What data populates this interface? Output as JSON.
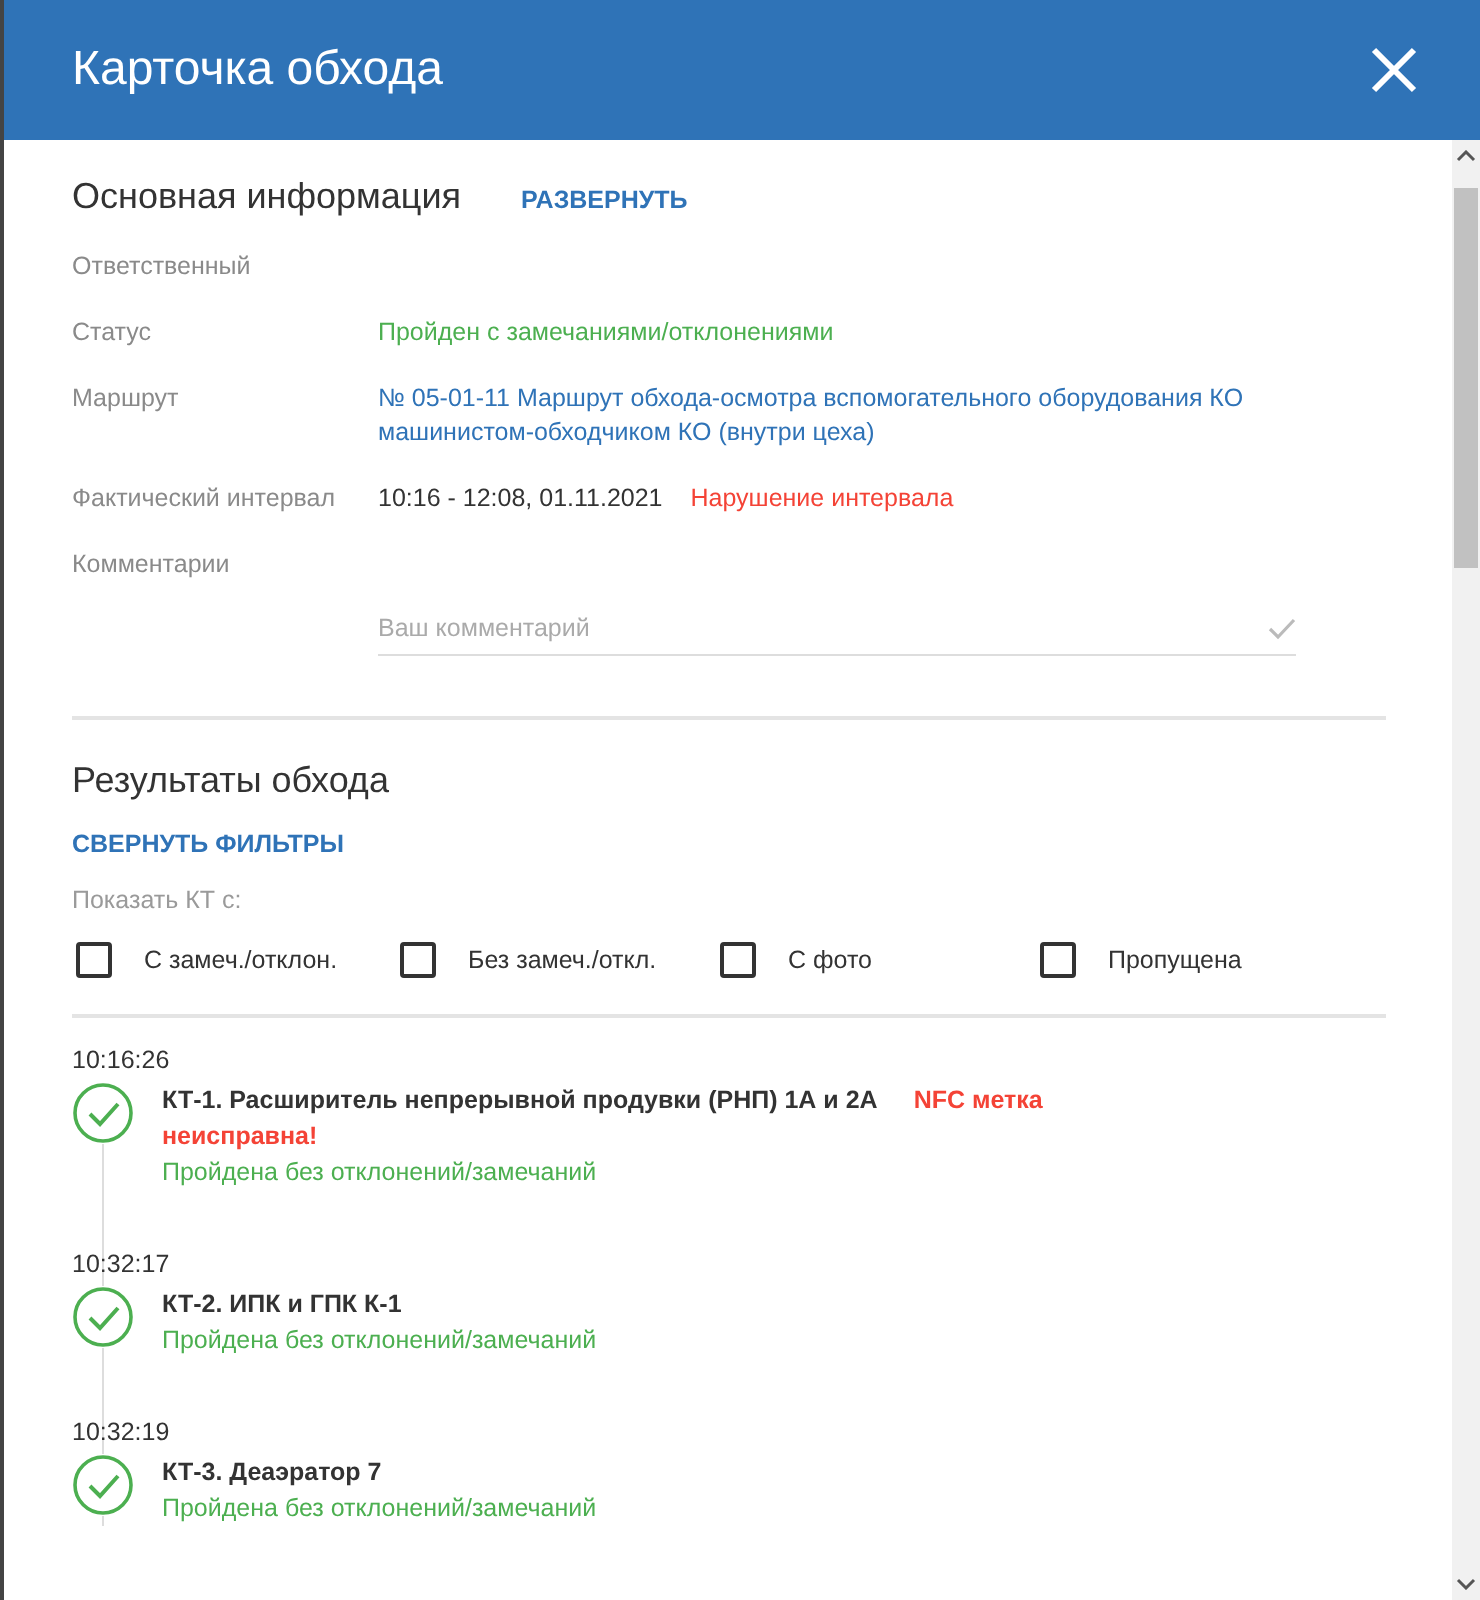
{
  "window": {
    "title": "Карточка обхода"
  },
  "main_info": {
    "title": "Основная информация",
    "toggle": "РАЗВЕРНУТЬ",
    "rows": [
      {
        "kind": "plain",
        "label": "Ответственный"
      },
      {
        "kind": "status",
        "label": "Статус",
        "value": "Пройден с замечаниями/отклонениями"
      },
      {
        "kind": "link",
        "label": "Маршрут",
        "value": "№ 05-01-11 Маршрут обхода-осмотра вспомогательного оборудования КО машинистом-обходчиком КО (внутри цеха)"
      },
      {
        "kind": "interval",
        "label": "Фактический интервал",
        "value": "10:16 - 12:08, 01.11.2021",
        "warning": "Нарушение интервала"
      },
      {
        "kind": "plain",
        "label": "Комментарии"
      }
    ],
    "comment": {
      "placeholder": "Ваш комментарий"
    }
  },
  "results": {
    "title": "Результаты обхода",
    "toggle": "СВЕРНУТЬ ФИЛЬТРЫ",
    "filter_label": "Показать КТ с:",
    "filters": [
      {
        "label": "С замеч./отклон.",
        "checked": false
      },
      {
        "label": "Без замеч./откл.",
        "checked": false
      },
      {
        "label": "С фото",
        "checked": false
      },
      {
        "label": "Пропущена",
        "checked": false
      }
    ],
    "items": [
      {
        "time": "10:16:26",
        "title": "КТ-1. Расширитель непрерывной продувки (РНП) 1А и 2А",
        "warning": "NFC метка неисправна!",
        "status": "Пройдена без отклонений/замечаний",
        "passed": true
      },
      {
        "time": "10:32:17",
        "title": "КТ-2. ИПК и ГПК К-1",
        "status": "Пройдена без отклонений/замечаний",
        "passed": true
      },
      {
        "time": "10:32:19",
        "title": "КТ-3. Деаэратор 7",
        "status": "Пройдена без отклонений/замечаний",
        "passed": true
      }
    ]
  }
}
